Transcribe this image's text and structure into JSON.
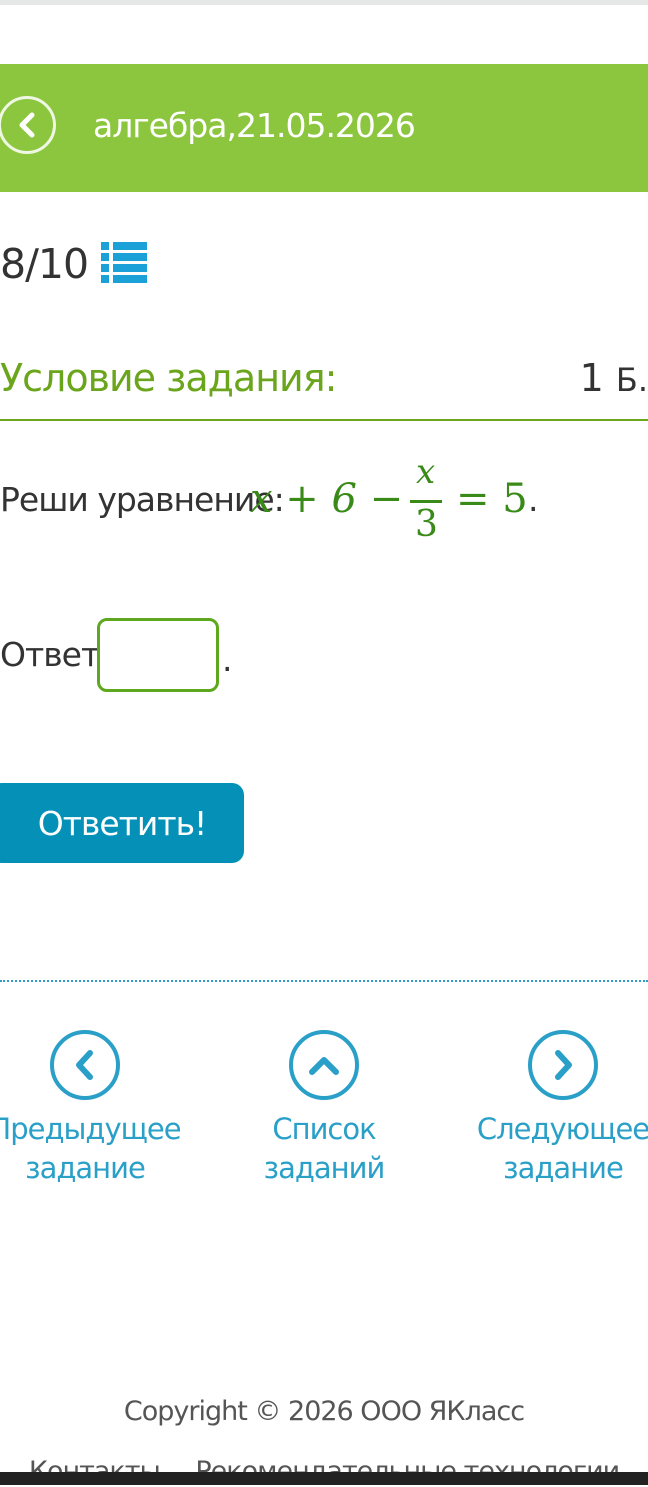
{
  "header": {
    "title": "алгебра,21.05.2026",
    "back_icon": "chevron-left-icon"
  },
  "progress": {
    "text": "8/10",
    "list_icon": "list-icon"
  },
  "condition": {
    "title": "Условие задания:",
    "points_value": "1",
    "points_unit": "Б."
  },
  "task": {
    "prompt": "Реши уравнение:",
    "equation_lhs": "x + 6 −",
    "fraction_num": "x",
    "fraction_den": "3",
    "equation_rhs": "= 5",
    "end": "."
  },
  "answer": {
    "label": "Ответ:",
    "value": "",
    "end": "."
  },
  "submit_label": "Ответить!",
  "nav": {
    "prev_line1": "Предыдущее",
    "prev_line2": "задание",
    "list_line1": "Список",
    "list_line2": "заданий",
    "next_line1": "Следующее",
    "next_line2": "задание"
  },
  "footer": {
    "copyright": "Copyright © 2026 ООО ЯКласс",
    "link_contacts": "Контакты",
    "link_recommend": "Рекомендательные технологии"
  },
  "colors": {
    "header_bg": "#8cc63f",
    "accent_green": "#6aa51c",
    "link_blue": "#2aa0c8",
    "button_blue": "#0591b7"
  }
}
